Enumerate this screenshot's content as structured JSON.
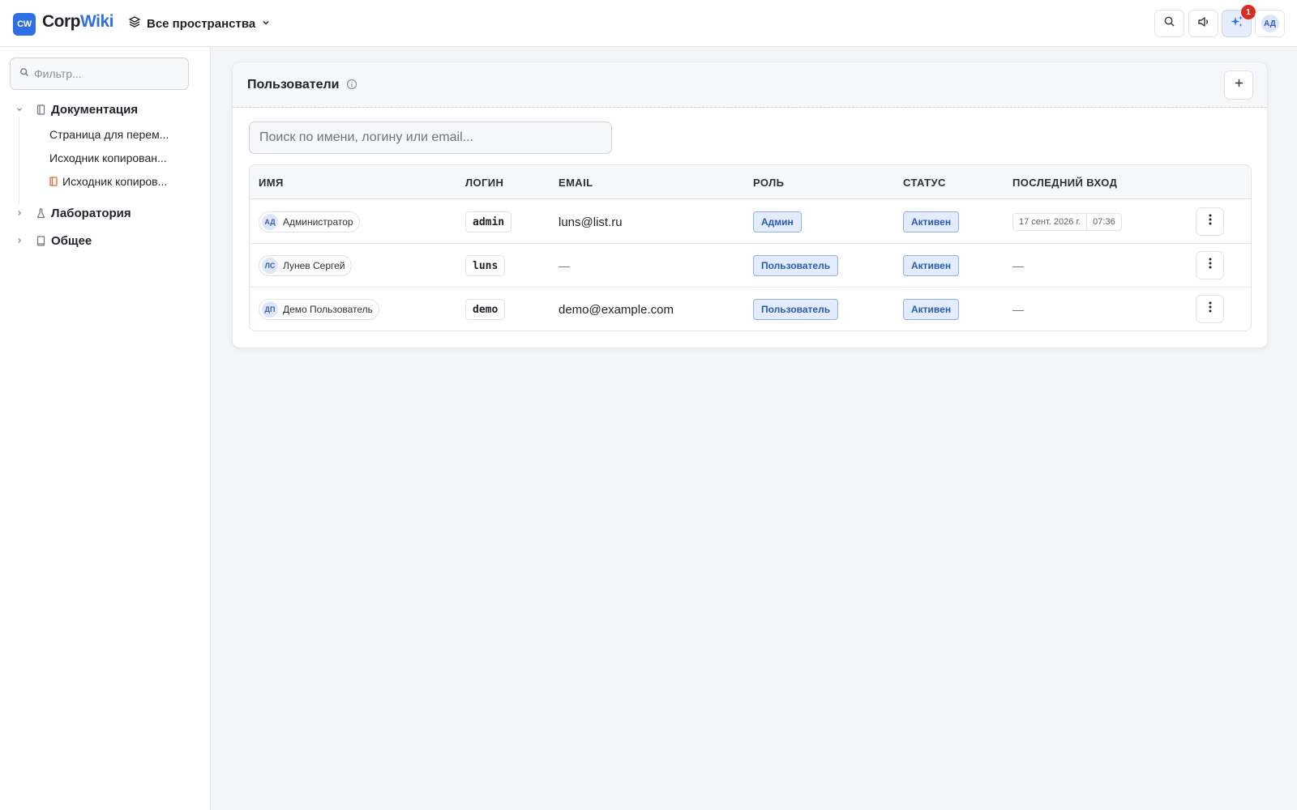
{
  "header": {
    "logo_mark": "CW",
    "logo_text_corp": "Corp",
    "logo_text_wiki": "Wiki",
    "space_selector_label": "Все пространства",
    "notifications_count": "1",
    "user_initials": "АД",
    "accent_color": "#2f6fe4"
  },
  "sidebar": {
    "filter_placeholder": "Фильтр...",
    "tree": [
      {
        "label": "Документация",
        "expanded": true,
        "icon": "document-icon",
        "children": [
          {
            "label": "Страница для перем..."
          },
          {
            "label": "Исходник копирован..."
          },
          {
            "label": "Исходник копиров...",
            "icon": "page-orange-icon"
          }
        ]
      },
      {
        "label": "Лаборатория",
        "expanded": false,
        "icon": "flask-icon"
      },
      {
        "label": "Общее",
        "expanded": false,
        "icon": "book-icon"
      }
    ]
  },
  "panel": {
    "title": "Пользователи",
    "search_placeholder": "Поиск по имени, логину или email...",
    "columns": [
      "Имя",
      "Логин",
      "Email",
      "Роль",
      "Статус",
      "Последний вход"
    ],
    "rows": [
      {
        "initials": "АД",
        "name": "Администратор",
        "login": "admin",
        "email": "luns@list.ru",
        "role": "Админ",
        "status": "Активен",
        "last_login_date": "17 сент. 2026 г.",
        "last_login_time": "07:36"
      },
      {
        "initials": "ЛС",
        "name": "Лунев Сергей",
        "login": "luns",
        "email": "—",
        "role": "Пользователь",
        "status": "Активен",
        "last_login": "—"
      },
      {
        "initials": "ДП",
        "name": "Демо Пользователь",
        "login": "demo",
        "email": "demo@example.com",
        "role": "Пользователь",
        "status": "Активен",
        "last_login": "—"
      }
    ]
  }
}
